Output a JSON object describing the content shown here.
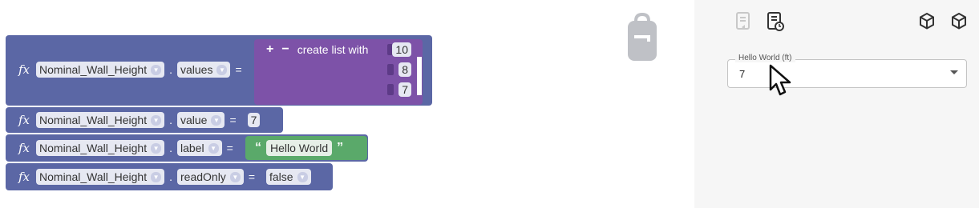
{
  "blocks": {
    "rows": [
      {
        "variable": "Nominal_Wall_Height",
        "property": "values",
        "equals": "="
      },
      {
        "variable": "Nominal_Wall_Height",
        "property": "value",
        "equals": "=",
        "value": "7"
      },
      {
        "variable": "Nominal_Wall_Height",
        "property": "label",
        "equals": "=",
        "text": "Hello World"
      },
      {
        "variable": "Nominal_Wall_Height",
        "property": "readOnly",
        "equals": "=",
        "bool": "false"
      }
    ],
    "dot": ".",
    "fx": "fx",
    "list": {
      "plus": "+",
      "minus": "−",
      "label": "create list with",
      "items": [
        "10",
        "8",
        "7"
      ]
    },
    "open_quote": "“",
    "close_quote": "”"
  },
  "panel": {
    "field_label": "Hello World (ft)",
    "field_value": "7"
  },
  "colors": {
    "block_blue": "#5b67a5",
    "block_purple": "#7d52a8",
    "block_green": "#5aa96a",
    "panel_bg": "#f6f6f6"
  },
  "icons": [
    "backpack-icon",
    "document-icon",
    "document-refresh-icon",
    "cube-icon",
    "cube-outline-icon",
    "cursor-icon"
  ]
}
